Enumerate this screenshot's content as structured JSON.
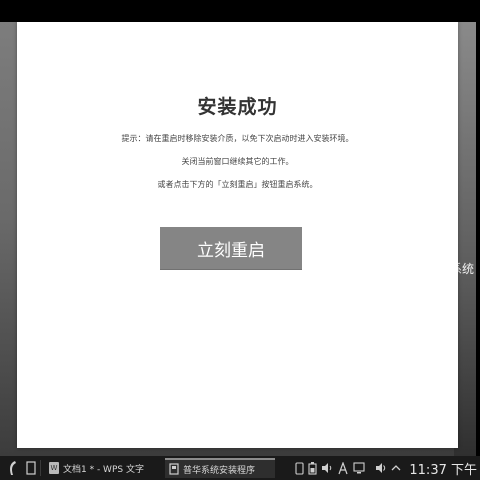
{
  "desktop": {
    "peek_text": "系统"
  },
  "dialog": {
    "title": "安装成功",
    "messages": [
      "提示：请在重启时移除安装介质，以免下次启动时进入安装环境。",
      "关闭当前窗口继续其它的工作。",
      "或者点击下方的「立刻重启」按钮重启系统。"
    ],
    "restart_button": "立刻重启"
  },
  "taskbar": {
    "tasks": [
      {
        "label": "文档1 * - WPS 文字",
        "icon": "wps-writer-icon",
        "active": false
      },
      {
        "label": "普华系统安装程序",
        "icon": "installer-icon",
        "active": true
      }
    ],
    "tray_icons": [
      "device-icon",
      "battery-icon",
      "speaker-icon",
      "network-icon",
      "display-icon",
      "volume-icon",
      "chevron-up-icon"
    ],
    "clock": "11:37 下午"
  }
}
